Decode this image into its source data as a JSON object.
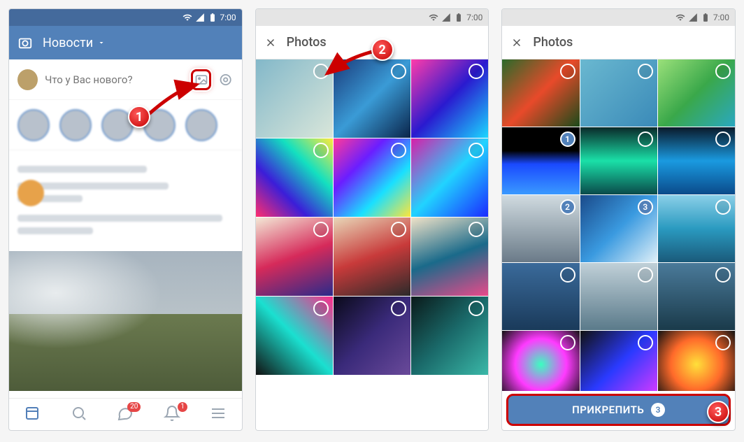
{
  "status": {
    "time": "7:00"
  },
  "screen1": {
    "header_title": "Новости",
    "composer_placeholder": "Что у Вас нового?",
    "badges": {
      "messages": "20",
      "notifs": "1"
    },
    "callout": "1"
  },
  "screen2": {
    "title": "Photos",
    "callout": "2",
    "thumbs": [
      {
        "bg": "linear-gradient(135deg,#83b8c9,#d9e6da)",
        "sel": null
      },
      {
        "bg": "linear-gradient(135deg,#1a3a7a,#3a9bd6,#0a244a)",
        "sel": null
      },
      {
        "bg": "linear-gradient(135deg,#ff3caa,#2a1acf,#1bd7ff)",
        "sel": null
      },
      {
        "bg": "linear-gradient(45deg,#ff2e6e,#3b1ed8,#13e0c0,#ffea3a)",
        "sel": null
      },
      {
        "bg": "linear-gradient(135deg,#ff3a9a,#6a1eff,#1ae0ff,#ffe63a)",
        "sel": null
      },
      {
        "bg": "linear-gradient(135deg,#d81ea8,#21d3ff,#1a2aff)",
        "sel": null
      },
      {
        "bg": "linear-gradient(160deg,#f3e9d6,#d62a5a,#2a2a8a)",
        "sel": null
      },
      {
        "bg": "linear-gradient(160deg,#e8d7b8,#c83a3a,#2a2a2a)",
        "sel": null
      },
      {
        "bg": "linear-gradient(160deg,#f0e2c8,#1a6a8a,#e84a8a)",
        "sel": null
      },
      {
        "bg": "linear-gradient(45deg,#111,#1ae0d0,#ff2a8a)",
        "sel": null
      },
      {
        "bg": "linear-gradient(135deg,#0a0a1a,#3a2a7a,#6a4a9a)",
        "sel": null
      },
      {
        "bg": "linear-gradient(135deg,#0a1a1a,#1a6a6a,#3ab8a8)",
        "sel": null
      }
    ]
  },
  "screen3": {
    "title": "Photos",
    "attach_label": "ПРИКРЕПИТЬ",
    "attach_count": "3",
    "callout": "3",
    "thumbs": [
      {
        "bg": "linear-gradient(135deg,#2a6a2a,#e84a2a,#1a4a1a)",
        "sel": null
      },
      {
        "bg": "linear-gradient(135deg,#6ab8d0,#3a8ab8)",
        "sel": null
      },
      {
        "bg": "linear-gradient(135deg,#9ae07a,#3aa84a,#2aa8c0)",
        "sel": null
      },
      {
        "bg": "linear-gradient(180deg,#000 0%,#000 35%,#1a4aff 55%,#3a9aff 100%)",
        "sel": "1"
      },
      {
        "bg": "linear-gradient(180deg,#0a2a2a,#1ae0a8,#0a4a4a)",
        "sel": null
      },
      {
        "bg": "linear-gradient(180deg,#0a1a2a,#1a9ae0,#0a4a8a)",
        "sel": null
      },
      {
        "bg": "linear-gradient(180deg,#d0dbe0,#6a7a88)",
        "sel": "2"
      },
      {
        "bg": "linear-gradient(135deg,#1a4a8a,#3a9ae0,#e0f0f8)",
        "sel": "3"
      },
      {
        "bg": "linear-gradient(180deg,#8acfe8,#2a9ac0,#1a5a7a)",
        "sel": null
      },
      {
        "bg": "linear-gradient(180deg,#3a6a9a,#1a3a5a)",
        "sel": null
      },
      {
        "bg": "linear-gradient(180deg,#c0d0d8,#5a7a8a)",
        "sel": null
      },
      {
        "bg": "linear-gradient(180deg,#4a7a9a,#1a3a4a)",
        "sel": null
      },
      {
        "bg": "radial-gradient(circle,#3affc0,#ff3aff,#111)",
        "sel": null
      },
      {
        "bg": "linear-gradient(135deg,#111,#2a3aff,#e03aff)",
        "sel": null
      },
      {
        "bg": "radial-gradient(circle,#ffe03a,#ff6a2a,#111)",
        "sel": null
      }
    ]
  }
}
